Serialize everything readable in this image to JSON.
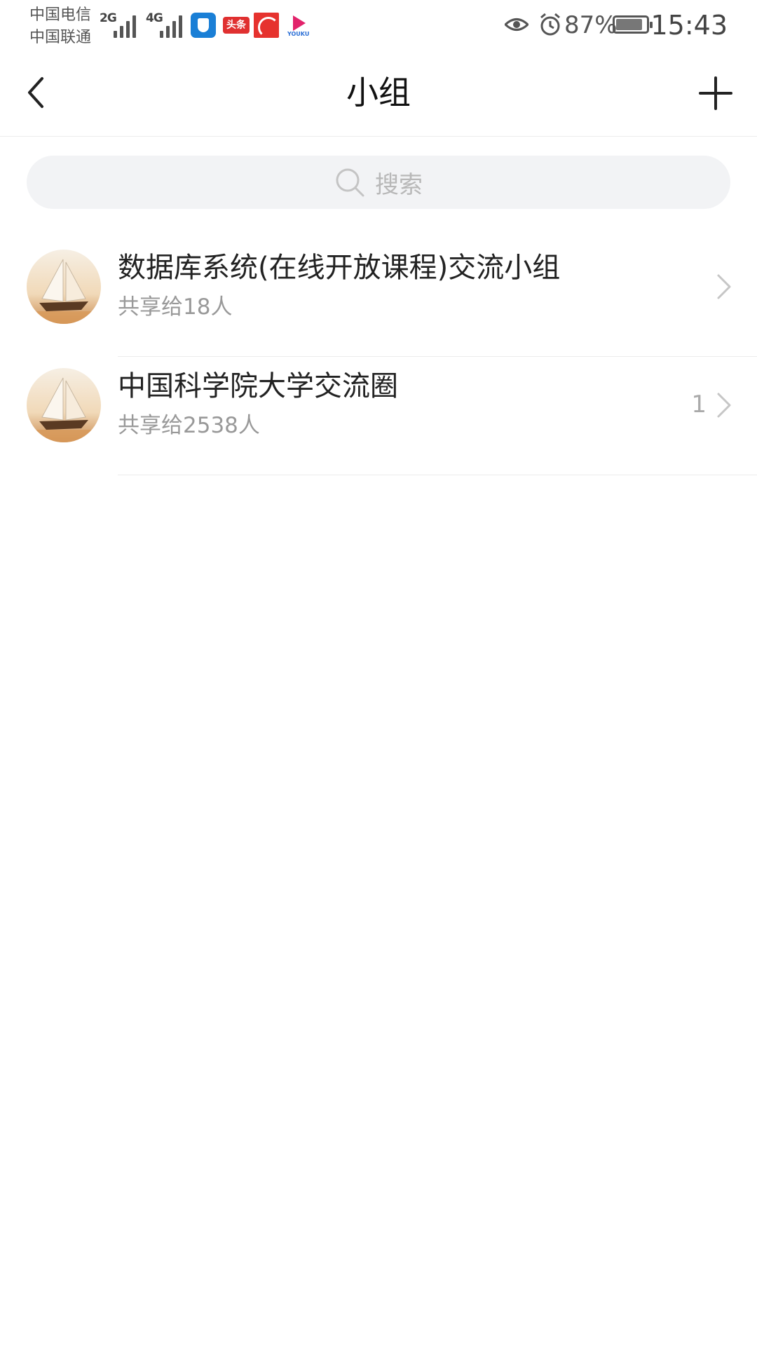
{
  "status_bar": {
    "carrier_1": "中国电信",
    "carrier_2": "中国联通",
    "network_1": "2G",
    "network_2": "4G",
    "toutiao_label": "头条",
    "battery_percent": "87%",
    "battery_level": 0.87,
    "time": "15:43",
    "icons": [
      "eye-icon",
      "alarm-icon",
      "battery-icon"
    ]
  },
  "nav": {
    "title": "小组",
    "back_icon": "chevron-left-icon",
    "add_icon": "plus-icon"
  },
  "search": {
    "placeholder": "搜索"
  },
  "groups": [
    {
      "name": "数据库系统(在线开放课程)交流小组",
      "subtitle": "共享给18人",
      "badge": ""
    },
    {
      "name": "中国科学院大学交流圈",
      "subtitle": "共享给2538人",
      "badge": "1"
    }
  ],
  "colors": {
    "title_text": "#111111",
    "secondary_text": "#999999",
    "search_bg": "#f2f3f5",
    "divider": "#ececec"
  }
}
